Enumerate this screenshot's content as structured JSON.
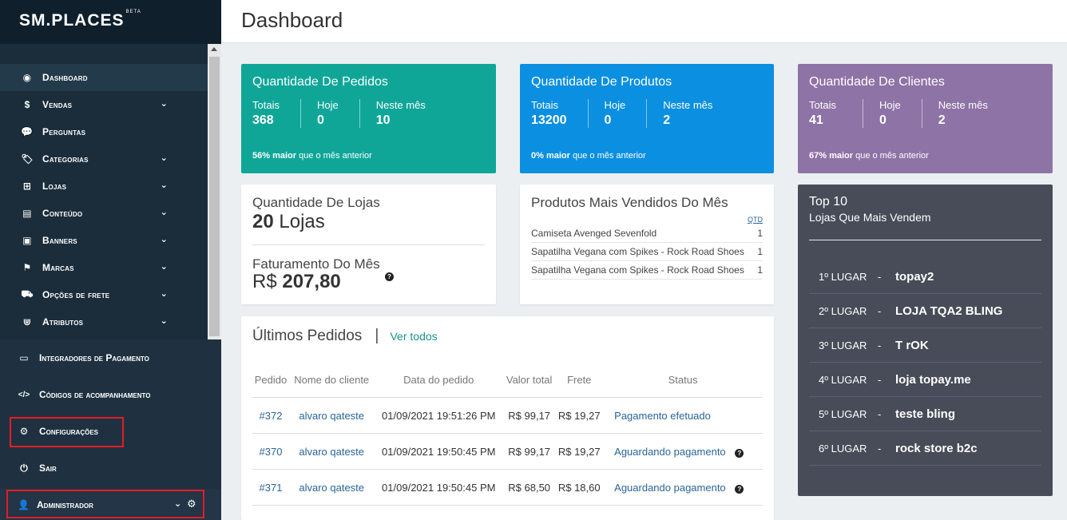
{
  "brand": {
    "name": "SM.PLACES",
    "badge": "BETA"
  },
  "header": {
    "title": "Dashboard"
  },
  "sidebar": {
    "items": [
      {
        "label": "Dashboard",
        "icon": "dashboard-icon",
        "glyph": "◉",
        "chevron": false
      },
      {
        "label": "Vendas",
        "icon": "dollar-icon",
        "glyph": "$",
        "chevron": true
      },
      {
        "label": "Perguntas",
        "icon": "chat-icon",
        "glyph": "💬",
        "chevron": false
      },
      {
        "label": "Categorias",
        "icon": "tags-icon",
        "glyph": "🏷",
        "chevron": true
      },
      {
        "label": "Lojas",
        "icon": "sitemap-icon",
        "glyph": "⊞",
        "chevron": true
      },
      {
        "label": "Conteúdo",
        "icon": "file-icon",
        "glyph": "▤",
        "chevron": true
      },
      {
        "label": "Banners",
        "icon": "image-icon",
        "glyph": "▣",
        "chevron": true
      },
      {
        "label": "Marcas",
        "icon": "flag-icon",
        "glyph": "⚑",
        "chevron": true
      },
      {
        "label": "Opções de frete",
        "icon": "truck-icon",
        "glyph": "⛟",
        "chevron": true
      },
      {
        "label": "Atributos",
        "icon": "magnet-icon",
        "glyph": "⋓",
        "chevron": true
      }
    ],
    "lower": [
      {
        "label": "Integradores de Pagamento",
        "glyph": "▭"
      },
      {
        "label": "Códigos de acompanhamento",
        "glyph": "</>"
      },
      {
        "label": "Configurações",
        "glyph": "⚙"
      },
      {
        "label": "Sair",
        "glyph": "⏻"
      }
    ],
    "admin": {
      "label": "Administrador"
    }
  },
  "stats": {
    "pedidos": {
      "title": "Quantidade De Pedidos",
      "totais_label": "Totais",
      "totais": "368",
      "hoje_label": "Hoje",
      "hoje": "0",
      "mes_label": "Neste mês",
      "mes": "10",
      "note_pct": "56% maior",
      "note_rest": "que o mês anterior",
      "color": "#0fa698"
    },
    "produtos": {
      "title": "Quantidade De Produtos",
      "totais_label": "Totais",
      "totais": "13200",
      "hoje_label": "Hoje",
      "hoje": "0",
      "mes_label": "Neste mês",
      "mes": "2",
      "note_pct": "0% maior",
      "note_rest": "que o mês anterior",
      "color": "#0b8fe0"
    },
    "clientes": {
      "title": "Quantidade De Clientes",
      "totais_label": "Totais",
      "totais": "41",
      "hoje_label": "Hoje",
      "hoje": "0",
      "mes_label": "Neste mês",
      "mes": "2",
      "note_pct": "67% maior",
      "note_rest": "que o mês anterior",
      "color": "#8e73a6"
    }
  },
  "lojas": {
    "title": "Quantidade De Lojas",
    "count": "20",
    "unit": "Lojas",
    "fat_title": "Faturamento Do Mês",
    "currency": "R$",
    "amount": "207,80"
  },
  "mais_vendidos": {
    "title": "Produtos Mais Vendidos Do Mês",
    "qtd_label": "QTD",
    "rows": [
      {
        "name": "Camiseta Avenged Sevenfold",
        "qtd": "1"
      },
      {
        "name": "Sapatilha Vegana com Spikes - Rock Road Shoes",
        "qtd": "1"
      },
      {
        "name": "Sapatilha Vegana com Spikes - Rock Road Shoes",
        "qtd": "1"
      }
    ]
  },
  "pedidos": {
    "title": "Últimos Pedidos",
    "ver_todos": "Ver todos",
    "columns": [
      "Pedido",
      "Nome do cliente",
      "Data do pedido",
      "Valor total",
      "Frete",
      "Status"
    ],
    "rows": [
      {
        "id": "#372",
        "cliente": "alvaro qateste",
        "data": "01/09/2021 19:51:26 PM",
        "valor": "R$ 99,17",
        "frete": "R$ 19,27",
        "status": "Pagamento efetuado",
        "help": ""
      },
      {
        "id": "#370",
        "cliente": "alvaro qateste",
        "data": "01/09/2021 19:50:45 PM",
        "valor": "R$ 99,17",
        "frete": "R$ 19,27",
        "status": "Aguardando pagamento",
        "help": "?"
      },
      {
        "id": "#371",
        "cliente": "alvaro qateste",
        "data": "01/09/2021 19:50:45 PM",
        "valor": "R$ 68,50",
        "frete": "R$ 18,60",
        "status": "Aguardando pagamento",
        "help": "?"
      }
    ]
  },
  "top10": {
    "title": "Top 10",
    "subtitle": "Lojas Que Mais Vendem",
    "rows": [
      {
        "pos": "1º LUGAR",
        "sep": "-",
        "name": "topay2"
      },
      {
        "pos": "2º LUGAR",
        "sep": "-",
        "name": "LOJA TQA2 BLING"
      },
      {
        "pos": "3º LUGAR",
        "sep": "-",
        "name": "T rOK"
      },
      {
        "pos": "4º LUGAR",
        "sep": "-",
        "name": "loja topay.me"
      },
      {
        "pos": "5º LUGAR",
        "sep": "-",
        "name": "teste bling"
      },
      {
        "pos": "6º LUGAR",
        "sep": "-",
        "name": "rock store b2c"
      }
    ]
  }
}
